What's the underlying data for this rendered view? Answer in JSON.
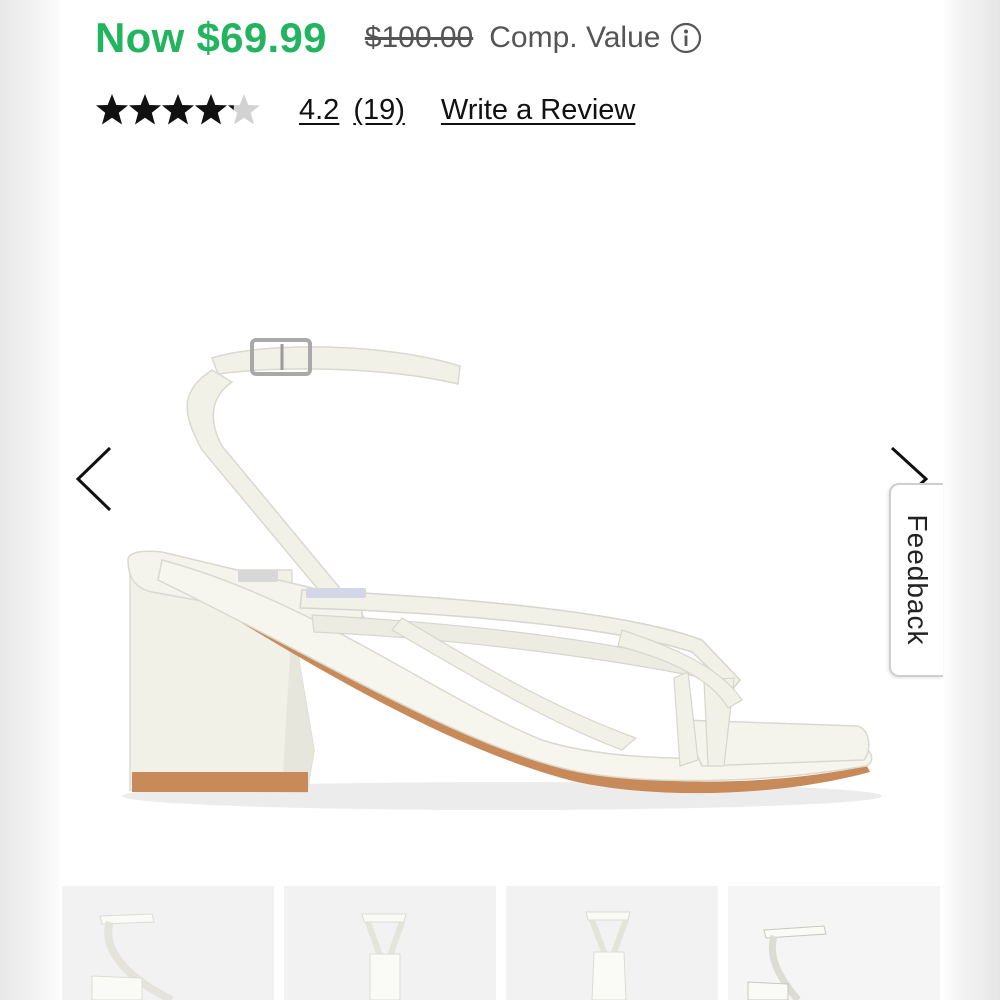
{
  "pricing": {
    "now_price": "Now $69.99",
    "original_price": "$100.00",
    "comp_label": "Comp. Value",
    "info_icon": "info-circle-icon"
  },
  "rating": {
    "value": 4.2,
    "value_label": "4.2",
    "max": 5,
    "count_label": "(19)",
    "write_review_label": "Write a Review"
  },
  "gallery": {
    "prev_icon": "chevron-left-icon",
    "next_icon": "chevron-right-icon",
    "main_image": "white strappy block-heel sandal",
    "thumbnails": [
      {
        "name": "thumbnail-side-view"
      },
      {
        "name": "thumbnail-front-view"
      },
      {
        "name": "thumbnail-back-view"
      },
      {
        "name": "thumbnail-angle-view"
      }
    ]
  },
  "feedback": {
    "label": "Feedback"
  },
  "colors": {
    "sale_green": "#23b460",
    "text_gray": "#555555",
    "sandal_white": "#f1f1e8",
    "sole_tan": "#c98a5a"
  }
}
